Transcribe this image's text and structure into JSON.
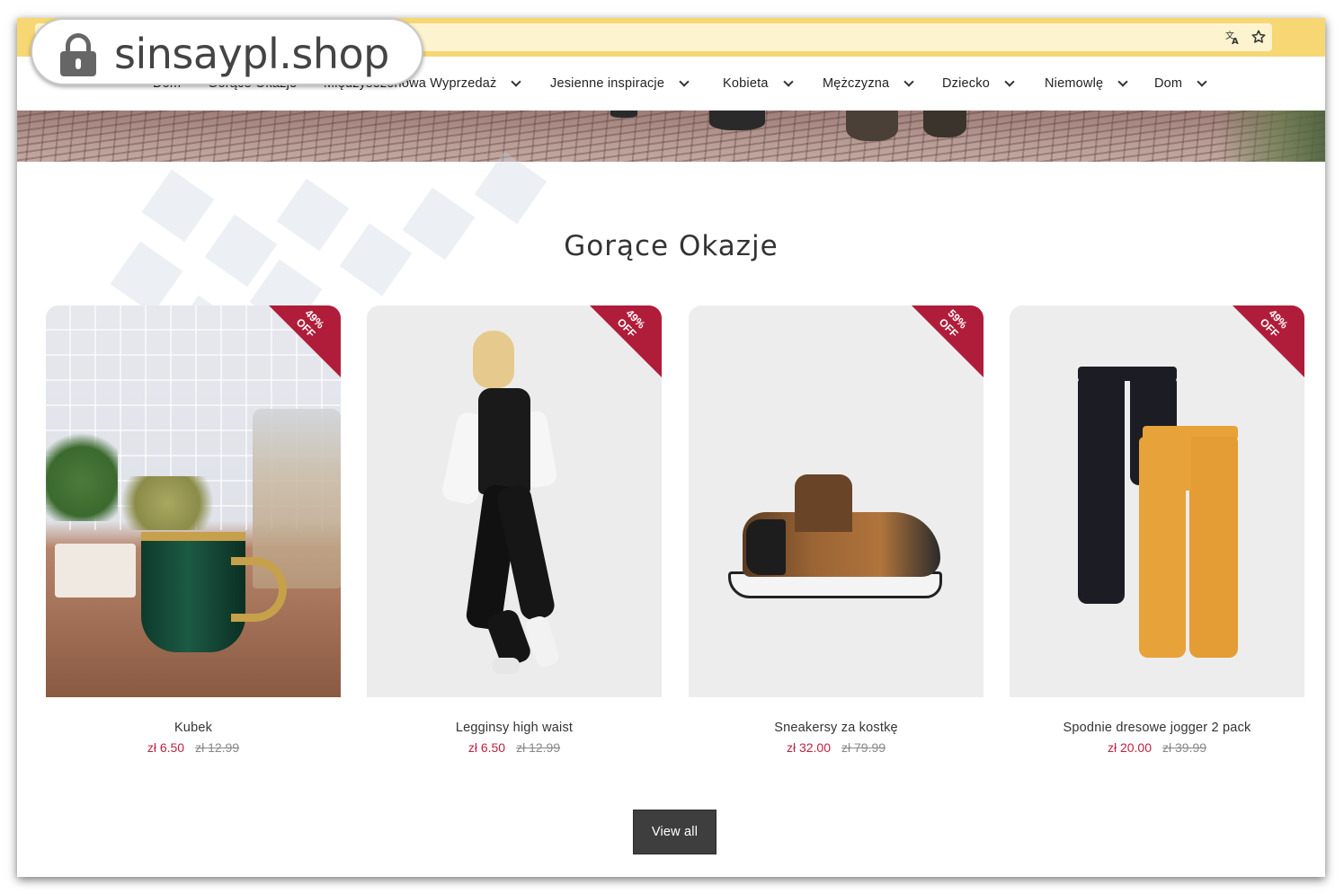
{
  "overlay": {
    "domain": "sinsaypl.shop"
  },
  "browser": {
    "translate_icon": "translate-icon",
    "bookmark_icon": "star-icon"
  },
  "nav": {
    "items": [
      {
        "label": "Dom",
        "has_dropdown": false
      },
      {
        "label": "Gorące Okazje",
        "has_dropdown": false
      },
      {
        "label": "Międzysezonowa Wyprzedaż",
        "has_dropdown": true
      },
      {
        "label": "Jesienne inspiracje",
        "has_dropdown": true
      },
      {
        "label": "Kobieta",
        "has_dropdown": true
      },
      {
        "label": "Mężczyzna",
        "has_dropdown": true
      },
      {
        "label": "Dziecko",
        "has_dropdown": true
      },
      {
        "label": "Niemowlę",
        "has_dropdown": true
      },
      {
        "label": "Dom",
        "has_dropdown": true
      }
    ]
  },
  "section": {
    "title": "Gorące Okazje"
  },
  "products": [
    {
      "name": "Kubek",
      "price": "zł 6.50",
      "old_price": "zł 12.99",
      "badge_pct": "49%",
      "badge_off": "OFF"
    },
    {
      "name": "Legginsy high waist",
      "price": "zł 6.50",
      "old_price": "zł 12.99",
      "badge_pct": "49%",
      "badge_off": "OFF"
    },
    {
      "name": "Sneakersy za kostkę",
      "price": "zł 32.00",
      "old_price": "zł 79.99",
      "badge_pct": "59%",
      "badge_off": "OFF"
    },
    {
      "name": "Spodnie dresowe jogger 2 pack",
      "price": "zł 20.00",
      "old_price": "zł 39.99",
      "badge_pct": "49%",
      "badge_off": "OFF"
    }
  ],
  "actions": {
    "view_all": "View all"
  },
  "colors": {
    "accent": "#b01d3a",
    "price": "#c02040",
    "address_bar": "#f7d774",
    "button": "#3e3e3e"
  }
}
